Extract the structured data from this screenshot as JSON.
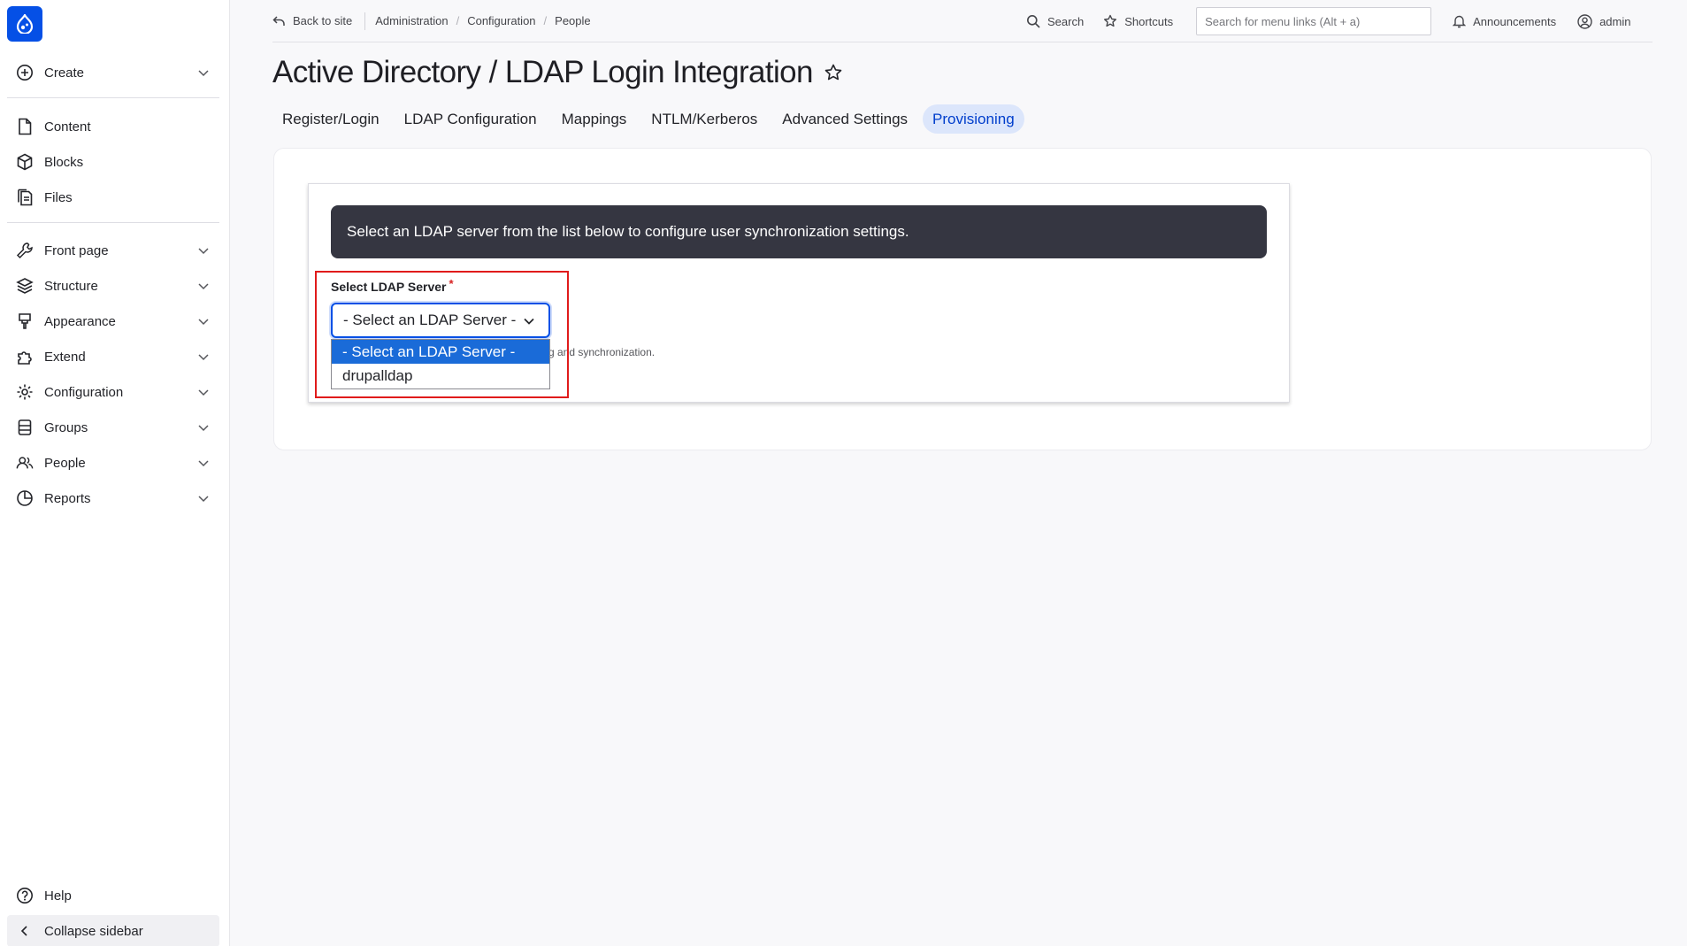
{
  "sidebar": {
    "create_label": "Create",
    "items": [
      {
        "label": "Content",
        "icon": "document-icon"
      },
      {
        "label": "Blocks",
        "icon": "cube-icon"
      },
      {
        "label": "Files",
        "icon": "files-icon"
      },
      {
        "label": "Front page",
        "icon": "wrench-icon"
      },
      {
        "label": "Structure",
        "icon": "layers-icon"
      },
      {
        "label": "Appearance",
        "icon": "brush-icon"
      },
      {
        "label": "Extend",
        "icon": "puzzle-icon"
      },
      {
        "label": "Configuration",
        "icon": "gear-icon"
      },
      {
        "label": "Groups",
        "icon": "database-icon"
      },
      {
        "label": "People",
        "icon": "people-icon"
      },
      {
        "label": "Reports",
        "icon": "pie-chart-icon"
      }
    ],
    "help_label": "Help",
    "collapse_label": "Collapse sidebar"
  },
  "topbar": {
    "back_label": "Back to site",
    "breadcrumbs": [
      "Administration",
      "Configuration",
      "People"
    ],
    "search_label": "Search",
    "shortcuts_label": "Shortcuts",
    "menu_search_placeholder": "Search for menu links (Alt + a)",
    "announcements_label": "Announcements",
    "user_label": "admin"
  },
  "page": {
    "title": "Active Directory / LDAP Login Integration",
    "tabs": [
      {
        "label": "Register/Login"
      },
      {
        "label": "LDAP Configuration"
      },
      {
        "label": "Mappings"
      },
      {
        "label": "NTLM/Kerberos"
      },
      {
        "label": "Advanced Settings"
      },
      {
        "label": "Provisioning",
        "active": true
      }
    ]
  },
  "form": {
    "message": "Select an LDAP server from the list below to configure user synchronization settings.",
    "field_label": "Select LDAP Server",
    "required_mark": "*",
    "selected_value": "- Select an LDAP Server -",
    "help_text_visible": "g and synchronization.",
    "options": [
      "- Select an LDAP Server -",
      "drupalldap"
    ]
  },
  "colors": {
    "brand": "#0550e6",
    "active_tab_bg": "#dce6fb",
    "message_bg": "#353641",
    "option_selected_bg": "#1a6bd8",
    "highlight_border": "#e01b1b"
  }
}
